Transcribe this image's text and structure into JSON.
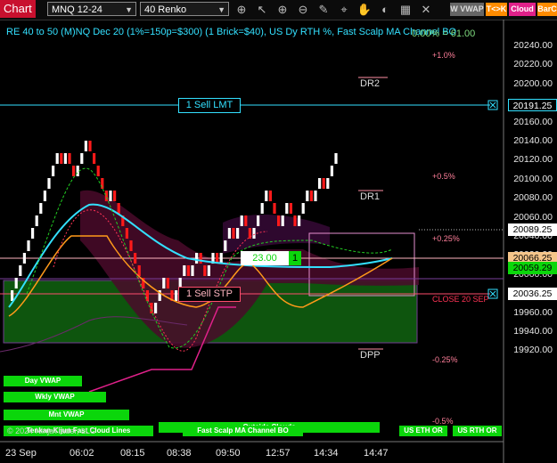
{
  "toolbar": {
    "chart_button": "Chart",
    "instrument": "MNQ 12-24",
    "bar_type": "40 Renko",
    "icons": [
      "crosshair-icon",
      "pointer-icon",
      "magnify-in-icon",
      "magnify-out-icon",
      "draw-icon",
      "measure-icon",
      "hand-icon",
      "hide-icon",
      "grid-icon",
      "indicators-icon"
    ],
    "buttons": [
      {
        "label": "W VWAP",
        "color": "#666666"
      },
      {
        "label": "T<>K",
        "color": "#ff8c00"
      },
      {
        "label": "Cloud",
        "color": "#e0218a"
      },
      {
        "label": "BarC",
        "color": "#ff8c00"
      }
    ]
  },
  "chart": {
    "title": "RE 40 to 50 (M)NQ Dec 20 (1%=150p=$300) (1 Brick=$40), US Dy RTH %, Fast Scalp MA Channel BO",
    "title_overlay": "0.00% = 61.00",
    "y_ticks": [
      "20240.00",
      "20220.00",
      "20200.00",
      "20180.00",
      "20160.00",
      "20140.00",
      "20120.00",
      "20100.00",
      "20080.00",
      "20060.00",
      "20040.00",
      "20020.00",
      "20000.00",
      "19980.00",
      "19960.00",
      "19940.00",
      "19920.00"
    ],
    "x_ticks": [
      "23 Sep",
      "06:02",
      "08:15",
      "08:38",
      "09:50",
      "12:57",
      "14:34",
      "14:47"
    ],
    "price_tags": {
      "sell_lmt": "20191.25",
      "last": "20089.25",
      "level1": "20066.25",
      "level2": "20059.29",
      "sell_stp": "20036.25"
    },
    "orders": {
      "sell_lmt": "1 Sell LMT",
      "sell_stp": "1 Sell STP",
      "pnl": "23.00",
      "qty": "1"
    },
    "levels": {
      "dr2": "DR2",
      "dr1": "DR1",
      "dpp": "DPP",
      "close": "CLOSE 20 SEP"
    },
    "percent_labels": [
      "+1.0%",
      "+0.5%",
      "+0.25%",
      "-0.25%",
      "-0.5%"
    ],
    "labels": {
      "day_vwap": "Day VWAP",
      "wkly_vwap": "Wkly VWAP",
      "mnt_vwap": "Mnt VWAP",
      "copyright": "© 2024 NinjaTrader, LLC",
      "tenkan": "Tenkan-Kijun Fast Cloud Lines",
      "outside_clouds": "Outside Clouds",
      "fast_scalp": "Fast Scalp MA Channel BO",
      "us_eth": "US ETH OR",
      "us_rth": "US RTH OR"
    }
  },
  "colors": {
    "bull": "#ffffff",
    "bear": "#ff1a1a",
    "vwap": "#33e0ff",
    "accent": "#0bd60b"
  }
}
